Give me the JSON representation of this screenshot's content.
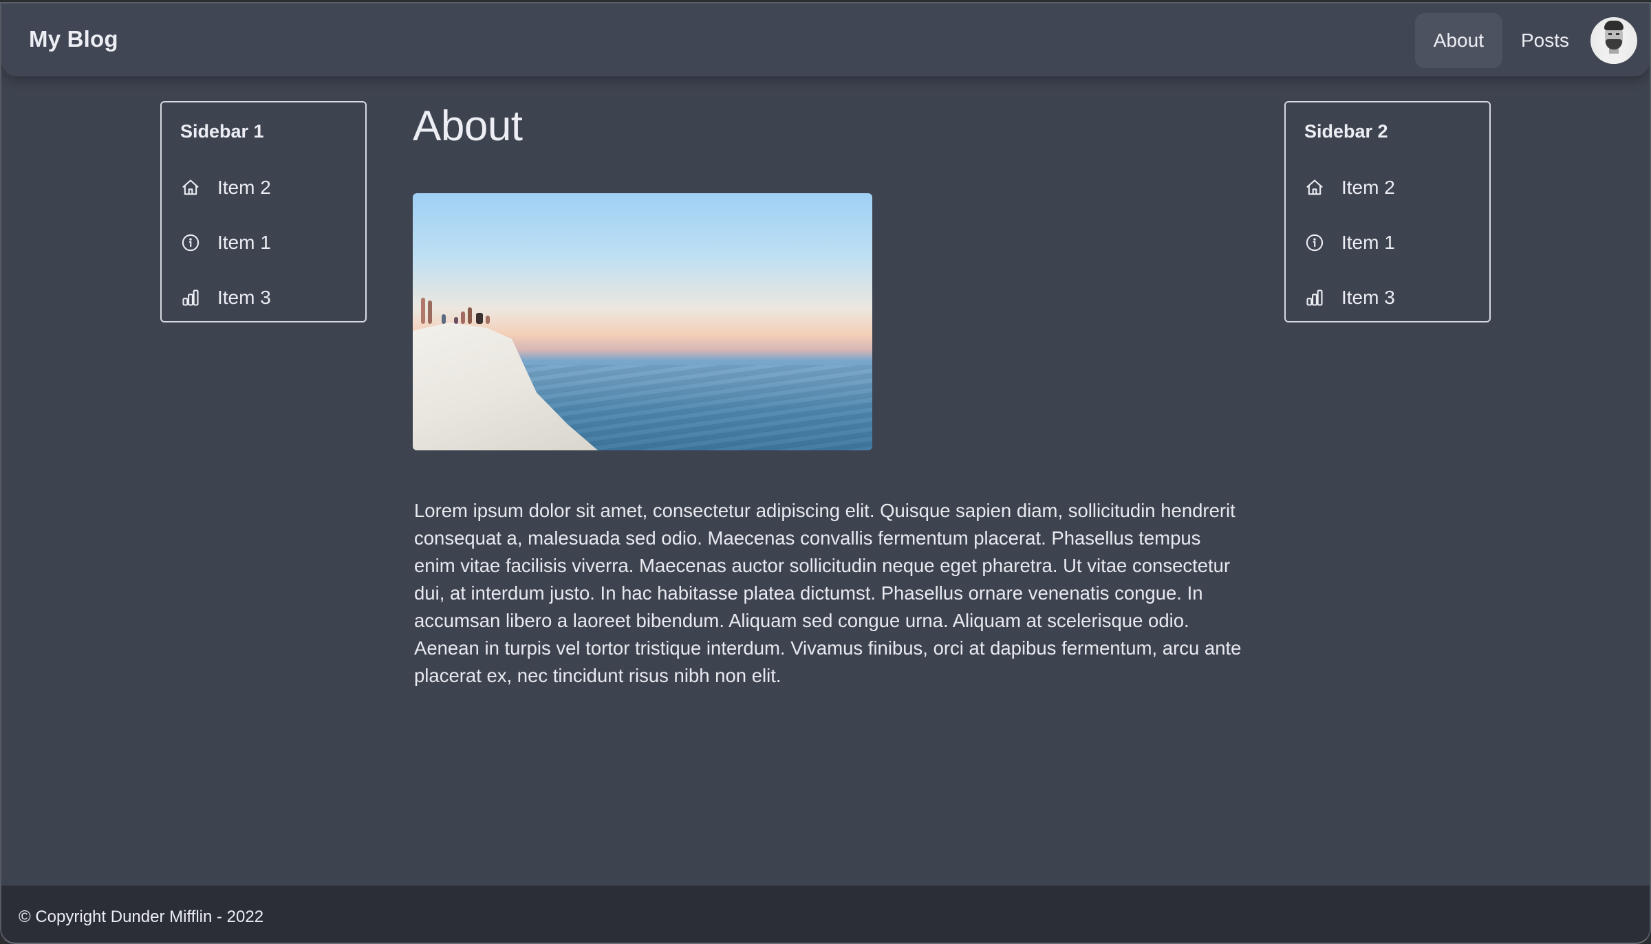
{
  "navbar": {
    "brand": "My Blog",
    "links": [
      {
        "label": "About",
        "active": true
      },
      {
        "label": "Posts",
        "active": false
      }
    ],
    "avatar_alt": "user-avatar"
  },
  "sidebars": [
    {
      "title": "Sidebar 1",
      "items": [
        {
          "label": "Item 2",
          "icon": "home-icon"
        },
        {
          "label": "Item 1",
          "icon": "info-icon"
        },
        {
          "label": "Item 3",
          "icon": "bar-chart-icon"
        }
      ]
    },
    {
      "title": "Sidebar 2",
      "items": [
        {
          "label": "Item 2",
          "icon": "home-icon"
        },
        {
          "label": "Item 1",
          "icon": "info-icon"
        },
        {
          "label": "Item 3",
          "icon": "bar-chart-icon"
        }
      ]
    }
  ],
  "main": {
    "title": "About",
    "image_alt": "White cliffs overlooking the sea at sunset",
    "body": "Lorem ipsum dolor sit amet, consectetur adipiscing elit. Quisque sapien diam, sollicitudin hendrerit consequat a, malesuada sed odio. Maecenas convallis fermentum placerat. Phasellus tempus enim vitae facilisis viverra. Maecenas auctor sollicitudin neque eget pharetra. Ut vitae consectetur dui, at interdum justo. In hac habitasse platea dictumst. Phasellus ornare venenatis congue. In accumsan libero a laoreet bibendum. Aliquam sed congue urna. Aliquam at scelerisque odio. Aenean in turpis vel tortor tristique interdum. Vivamus finibus, orci at dapibus fermentum, arcu ante placerat ex, nec tincidunt risus nibh non elit."
  },
  "footer": {
    "text": "© Copyright Dunder Mifflin - 2022"
  },
  "colors": {
    "background": "#3e4350",
    "navbar": "#414654",
    "active_nav": "#4d5260",
    "footer": "#2c2e37",
    "text": "#e8eaef"
  }
}
